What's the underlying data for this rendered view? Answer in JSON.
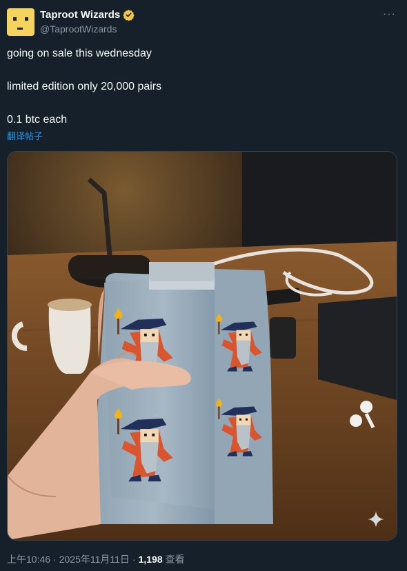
{
  "author": {
    "display_name": "Taproot Wizards",
    "handle": "@TaprootWizards",
    "verified": true,
    "verified_color": "#f4c542"
  },
  "tweet": {
    "lines": [
      "going on sale this wednesday",
      "",
      "limited edition only 20,000 pairs",
      "",
      "0.1 btc each"
    ],
    "translate_label": "翻译帖子"
  },
  "media": {
    "icon": "sparkle-icon"
  },
  "footer": {
    "time": "上午10:46",
    "separator": "·",
    "date": "2025年11月11日",
    "separator2": "·",
    "views_count": "1,198",
    "views_label": "查看"
  },
  "menu": {
    "more_icon": "more-icon",
    "more_label": "···"
  },
  "colors": {
    "background": "#15202b",
    "text": "#f7f9f9",
    "muted": "#8b98a5",
    "link": "#1d9bf0",
    "border": "#38444d"
  }
}
